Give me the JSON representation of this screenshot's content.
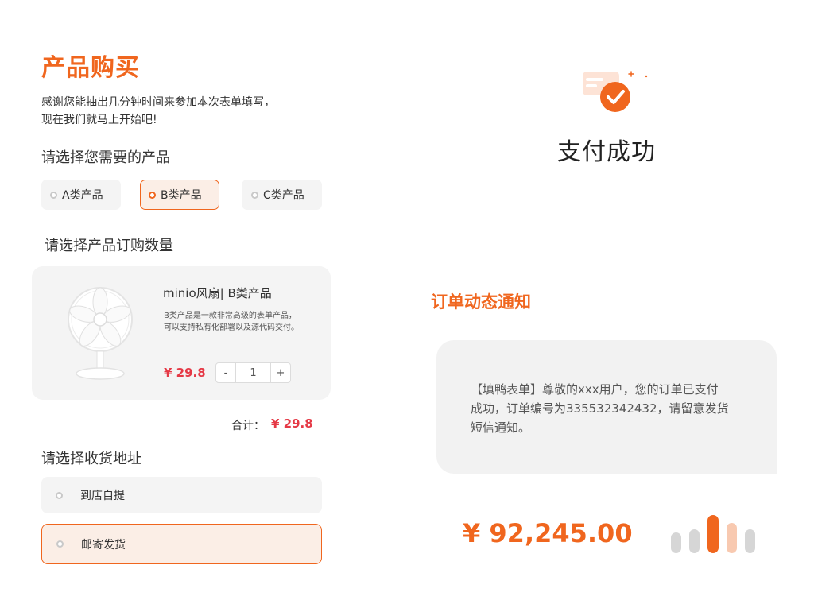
{
  "purchase": {
    "title": "产品购买",
    "intro_line1": "感谢您能抽出几分钟时间来参加本次表单填写，",
    "intro_line2": "现在我们就马上开始吧!",
    "product_section": "请选择您需要的产品",
    "product_options": [
      {
        "label": "A类产品",
        "selected": false
      },
      {
        "label": "B类产品",
        "selected": true
      },
      {
        "label": "C类产品",
        "selected": false
      }
    ],
    "quantity_section": "请选择产品订购数量",
    "product": {
      "name": "minio风扇| B类产品",
      "desc_line1": "B类产品是一款非常高级的表单产品，",
      "desc_line2": "可以支持私有化部署以及源代码交付。",
      "price": "¥ 29.8",
      "stepper": {
        "minus": "-",
        "value": "1",
        "plus": "+"
      }
    },
    "total_label": "合计：",
    "total_value": "¥ 29.8",
    "address_section": "请选择收货地址",
    "address_options": [
      {
        "label": "到店自提",
        "selected": false
      },
      {
        "label": "邮寄发货",
        "selected": true
      }
    ]
  },
  "payment": {
    "title": "支付成功",
    "icon": "card-check-icon",
    "notify_title": "订单动态通知",
    "message_line1": "【填鸭表单】尊敬的xxx用户，您的订单已支付",
    "message_line2": "成功，订单编号为335532342432，请留意发货",
    "message_line3": "短信通知。",
    "amount": "¥ 92,245.00"
  },
  "colors": {
    "accent": "#f0661e",
    "price_red": "#e53946",
    "bar_gray": "#d6d6d6",
    "bar_light": "#f8c9b0"
  }
}
